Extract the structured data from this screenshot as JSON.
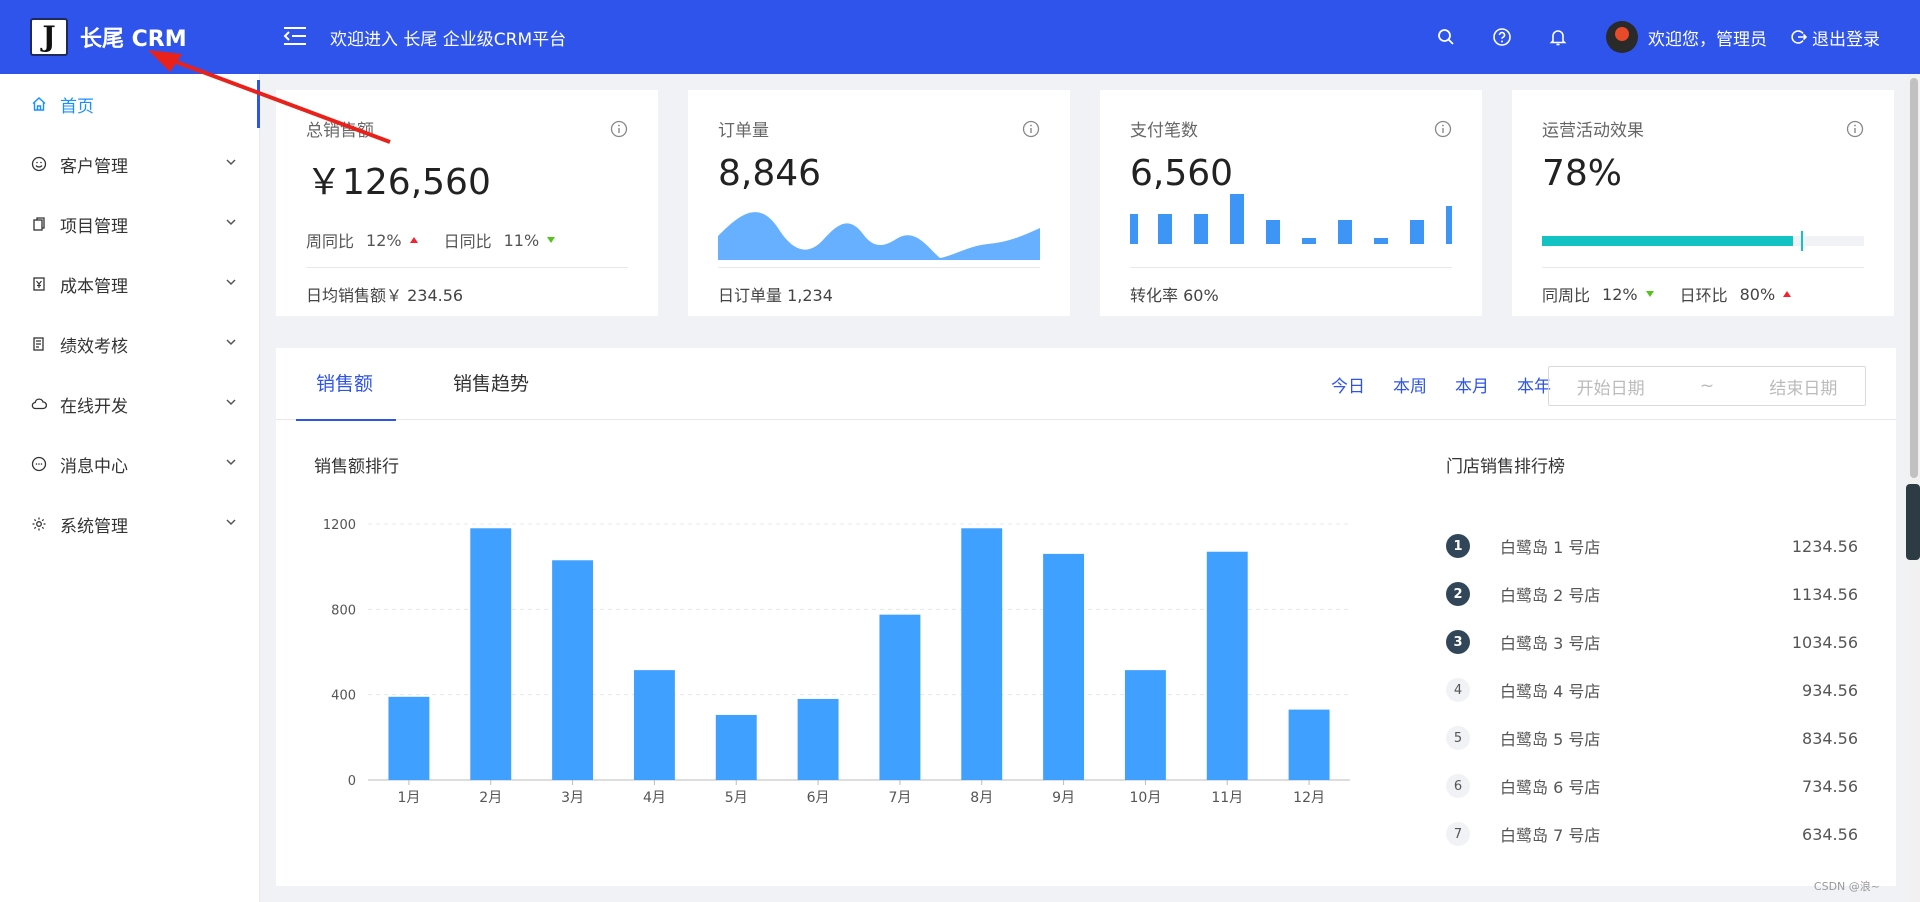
{
  "header": {
    "logo_letter": "J",
    "title": "长尾 CRM",
    "welcome": "欢迎进入 长尾 企业级CRM平台",
    "user": "欢迎您，管理员",
    "logout": "退出登录",
    "bg_color": "#2f54eb"
  },
  "sidebar": {
    "items": [
      {
        "label": "首页",
        "icon": "home-icon"
      },
      {
        "label": "客户管理",
        "icon": "smile-icon"
      },
      {
        "label": "项目管理",
        "icon": "copy-icon"
      },
      {
        "label": "成本管理",
        "icon": "money-icon"
      },
      {
        "label": "绩效考核",
        "icon": "audit-icon"
      },
      {
        "label": "在线开发",
        "icon": "cloud-icon"
      },
      {
        "label": "消息中心",
        "icon": "message-icon"
      },
      {
        "label": "系统管理",
        "icon": "setting-icon"
      }
    ]
  },
  "cards": [
    {
      "title": "总销售额",
      "value": "￥126,560",
      "wow_label": "周同比",
      "wow": "12%",
      "dod_label": "日同比",
      "dod": "11%",
      "footer": "日均销售额￥ 234.56"
    },
    {
      "title": "订单量",
      "value": "8,846",
      "footer": "日订单量 1,234"
    },
    {
      "title": "支付笔数",
      "value": "6,560",
      "footer": "转化率 60%"
    },
    {
      "title": "运营活动效果",
      "value": "78%",
      "progress": 0.78,
      "wow_label": "同周比",
      "wow": "12%",
      "dod_label": "日环比",
      "dod": "80%"
    }
  ],
  "panel": {
    "tabs": [
      "销售额",
      "销售趋势"
    ],
    "ranges": [
      "今日",
      "本周",
      "本月",
      "本年"
    ],
    "start_placeholder": "开始日期",
    "range_sep": "~",
    "end_placeholder": "结束日期",
    "chart_title": "销售额排行",
    "rank_title": "门店销售排行榜",
    "ranking": [
      {
        "rank": "1",
        "name": "白鹭岛 1 号店",
        "value": "1234.56"
      },
      {
        "rank": "2",
        "name": "白鹭岛 2 号店",
        "value": "1134.56"
      },
      {
        "rank": "3",
        "name": "白鹭岛 3 号店",
        "value": "1034.56"
      },
      {
        "rank": "4",
        "name": "白鹭岛 4 号店",
        "value": "934.56"
      },
      {
        "rank": "5",
        "name": "白鹭岛 5 号店",
        "value": "834.56"
      },
      {
        "rank": "6",
        "name": "白鹭岛 6 号店",
        "value": "734.56"
      },
      {
        "rank": "7",
        "name": "白鹭岛 7 号店",
        "value": "634.56"
      }
    ]
  },
  "chart_data": {
    "type": "bar",
    "categories": [
      "1月",
      "2月",
      "3月",
      "4月",
      "5月",
      "6月",
      "7月",
      "8月",
      "9月",
      "10月",
      "11月",
      "12月"
    ],
    "values": [
      390,
      1180,
      1030,
      515,
      305,
      380,
      775,
      1180,
      1060,
      515,
      1070,
      330
    ],
    "yticks": [
      0,
      400,
      800,
      1200
    ],
    "ylim": [
      0,
      1200
    ],
    "color": "#40a0ff"
  },
  "watermark": "CSDN @浪~"
}
